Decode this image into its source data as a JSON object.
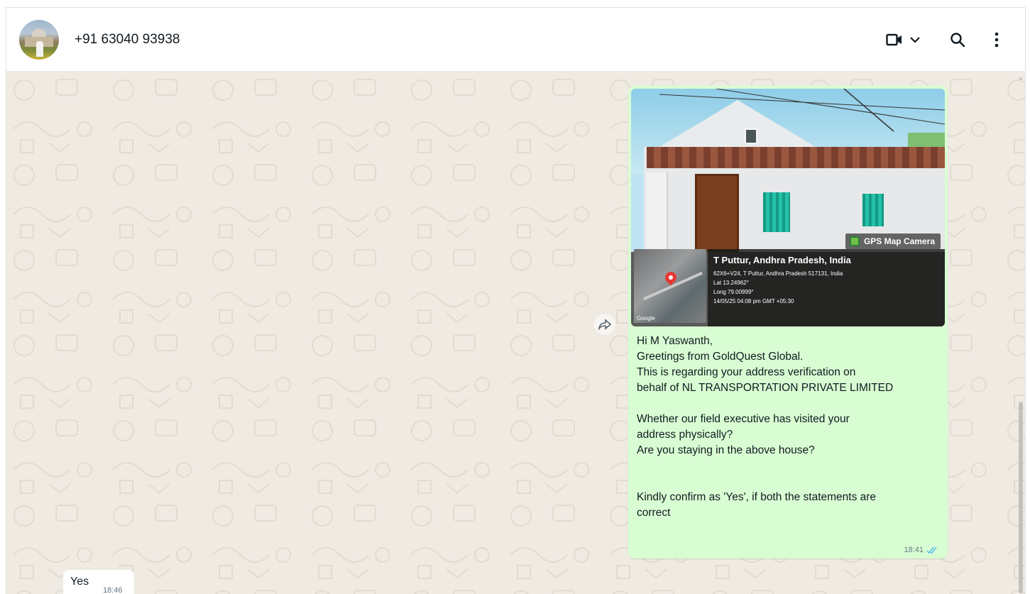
{
  "header": {
    "contact_name": "+91 63040 93938"
  },
  "outgoing_message": {
    "image": {
      "gps_badge": "GPS Map Camera",
      "location_title": "T Puttur, Andhra Pradesh, India",
      "address": "62X6+V24, T Puttur, Andhra Pradesh 517131, India",
      "lat": "Lat 13.24962°",
      "long": "Long 79.00999°",
      "datetime": "14/05/25 04:08 pm GMT +05:30",
      "map_label": "Google"
    },
    "lines": [
      "Hi M Yaswanth,",
      "Greetings from GoldQuest Global.",
      "This is regarding your address verification on",
      "behalf of NL TRANSPORTATION PRIVATE LIMITED",
      "",
      "Whether our field executive has visited your",
      "address physically?",
      "Are you staying in the above house?",
      "",
      "",
      "Kindly confirm as 'Yes', if both the statements are",
      "correct"
    ],
    "time": "18:41",
    "status": "read"
  },
  "incoming_message": {
    "text": "Yes",
    "time": "18:46"
  },
  "colors": {
    "chat_bg": "#efeae2",
    "outgoing_bubble": "#d9fdd3",
    "incoming_bubble": "#ffffff",
    "read_tick": "#53bdeb"
  }
}
